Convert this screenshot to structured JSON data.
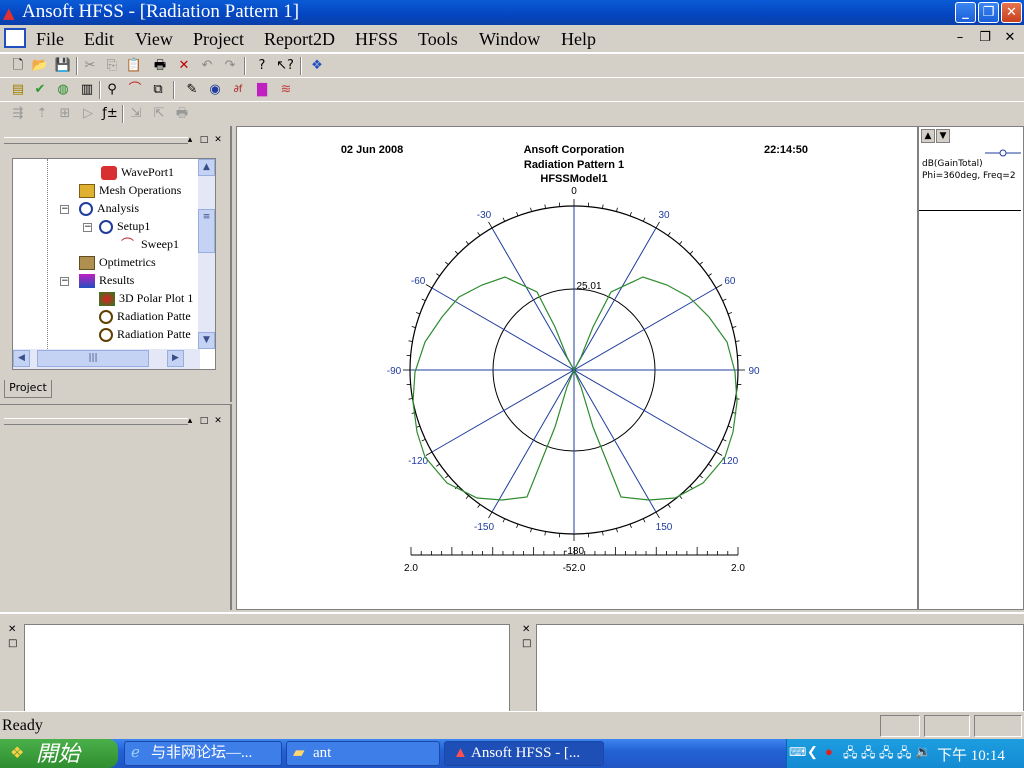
{
  "window": {
    "title": "Ansoft HFSS - [Radiation Pattern 1]"
  },
  "menu": [
    "File",
    "Edit",
    "View",
    "Project",
    "Report2D",
    "HFSS",
    "Tools",
    "Window",
    "Help"
  ],
  "tree": {
    "items": [
      {
        "label": "WavePort1",
        "icon": "waveport-icon"
      },
      {
        "label": "Mesh Operations",
        "icon": "mesh-icon"
      },
      {
        "label": "Analysis",
        "icon": "analysis-icon"
      },
      {
        "label": "Setup1",
        "icon": "setup-icon"
      },
      {
        "label": "Sweep1",
        "icon": "sweep-icon"
      },
      {
        "label": "Optimetrics",
        "icon": "optimetrics-icon"
      },
      {
        "label": "Results",
        "icon": "results-icon"
      },
      {
        "label": "3D Polar Plot 1",
        "icon": "polar3d-icon"
      },
      {
        "label": "Radiation Patte",
        "icon": "radiation-icon"
      },
      {
        "label": "Radiation Patte",
        "icon": "radiation-icon"
      }
    ]
  },
  "project_tab": "Project",
  "plot": {
    "date": "02 Jun 2008",
    "company": "Ansoft Corporation",
    "title": "Radiation Pattern 1",
    "model": "HFSSModel1",
    "time": "22:14:50",
    "inner_ring_label": "25.01",
    "scale_left": "2.0",
    "scale_mid": "-52.0",
    "scale_right": "2.0"
  },
  "chart_data": {
    "type": "polar",
    "angle_labels": [
      "0",
      "30",
      "60",
      "90",
      "120",
      "150",
      "-180",
      "-150",
      "-120",
      "-90",
      "-60",
      "-30"
    ],
    "series": [
      {
        "name": "dB(GainTotal) Phi=360deg, Freq=2",
        "color": "#2e8b2e"
      }
    ]
  },
  "legend": {
    "line1": "dB(GainTotal)",
    "line2": "Phi=360deg, Freq=2"
  },
  "status": {
    "text": "Ready"
  },
  "taskbar": {
    "start": "開始",
    "items": [
      "与非网论坛—...",
      "ant",
      "Ansoft HFSS - [..."
    ],
    "clock": "下午 10:14"
  },
  "colors": {
    "accent": "#0a5bd6",
    "plot_axis": "#1f3c9e",
    "plot_trace": "#2e8b2e"
  }
}
